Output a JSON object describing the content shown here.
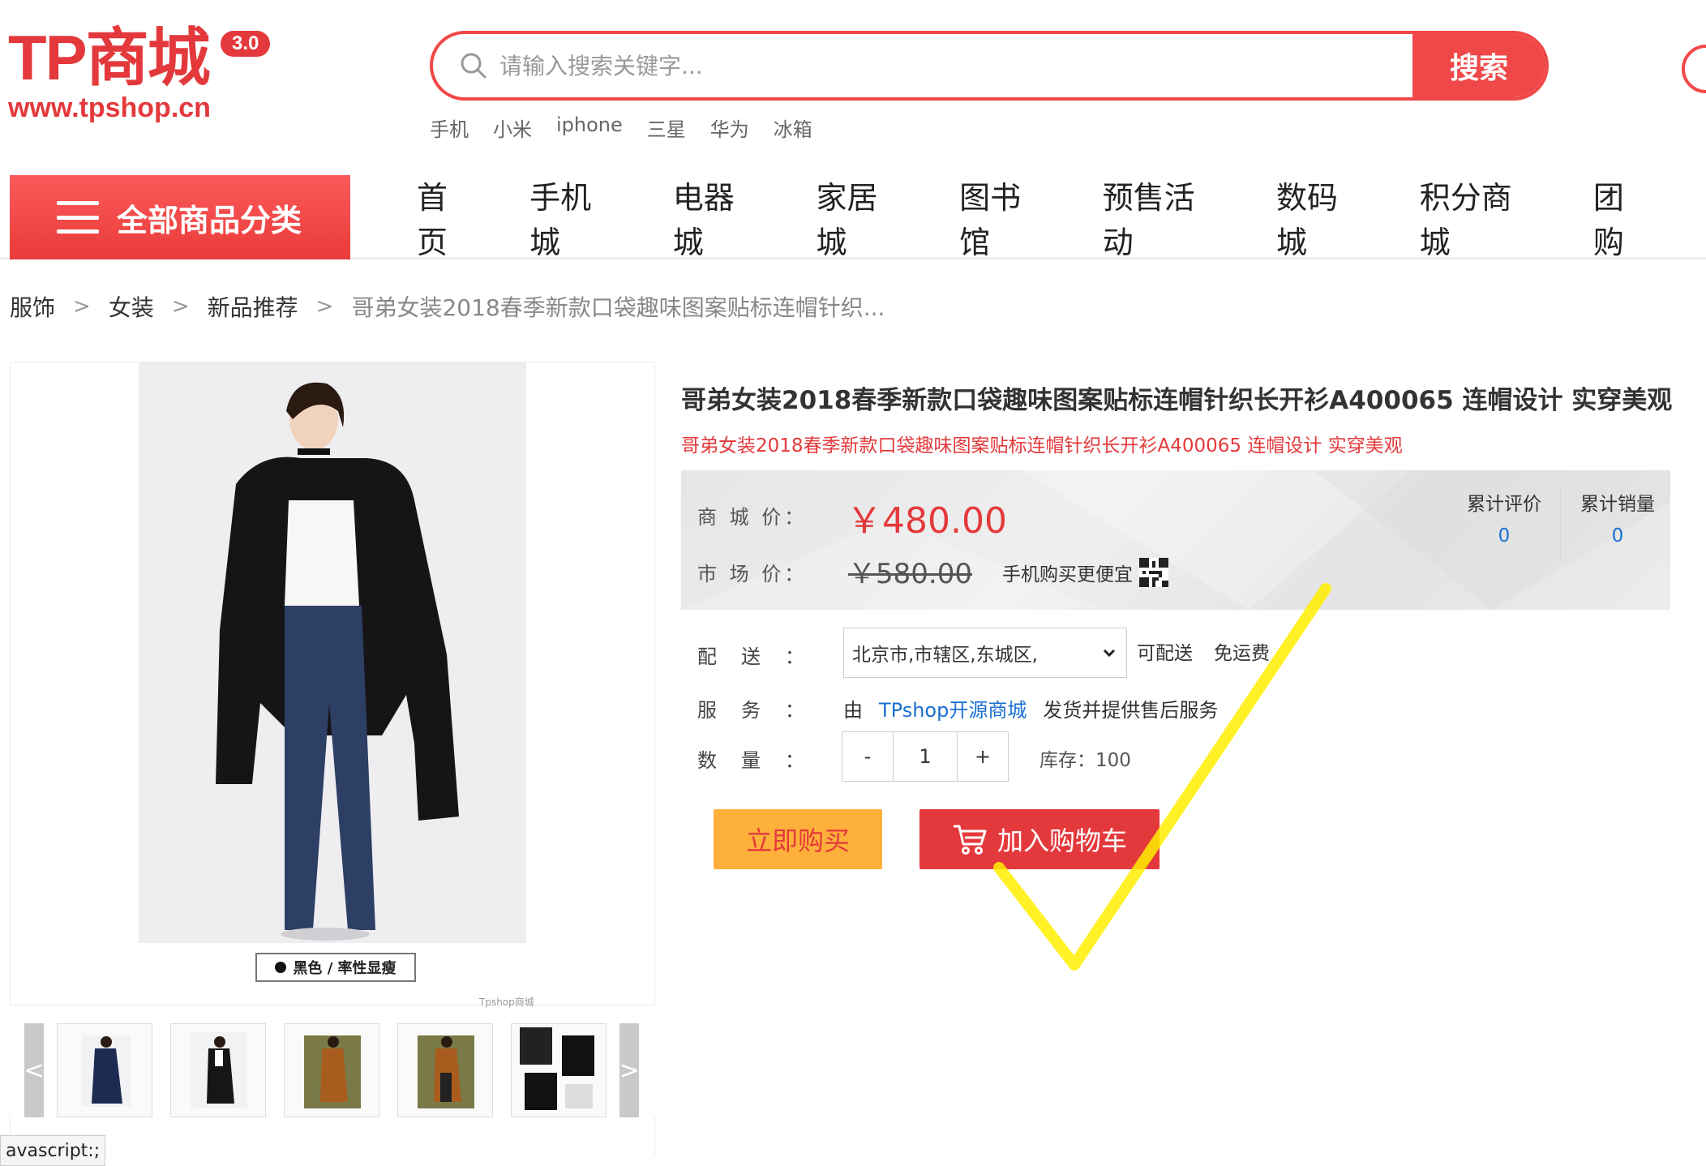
{
  "header": {
    "logo_text": "TP商城",
    "logo_version": "3.0",
    "logo_url": "www.tpshop.cn",
    "search_placeholder": "请输入搜索关键字...",
    "search_button": "搜索",
    "hot_keywords": [
      "手机",
      "小米",
      "iphone",
      "三星",
      "华为",
      "冰箱"
    ]
  },
  "nav": {
    "category_button": "全部商品分类",
    "items": [
      "首页",
      "手机城",
      "电器城",
      "家居城",
      "图书馆",
      "预售活动",
      "数码城",
      "积分商城",
      "团购"
    ]
  },
  "breadcrumb": [
    "服饰",
    "女装",
    "新品推荐",
    "哥弟女装2018春季新款口袋趣味图案贴标连帽针织..."
  ],
  "gallery": {
    "tag_text": "黑色 / 率性显瘦",
    "watermark": "Tpshop商城",
    "prev_arrow": "<",
    "next_arrow": ">"
  },
  "status_bar": "avascript:;",
  "product": {
    "title": "哥弟女装2018春季新款口袋趣味图案贴标连帽针织长开衫A400065 连帽设计 实穿美观",
    "subtitle": "哥弟女装2018春季新款口袋趣味图案贴标连帽针织长开衫A400065 连帽设计 实穿美观",
    "shop_price_label": "商 城 价：",
    "shop_price": "￥480.00",
    "market_price_label": "市 场 价：",
    "market_price": "￥580.00",
    "mobile_promo": "手机购买更便宜",
    "reviews_label": "累计评价",
    "reviews_count": "0",
    "sales_label": "累计销量",
    "sales_count": "0",
    "delivery_label": "配送：",
    "delivery_region": "北京市,市辖区,东城区,",
    "delivery_status": "可配送",
    "shipping_fee": "免运费",
    "service_label": "服务：",
    "service_prefix": "由",
    "service_shop": "TPshop开源商城",
    "service_suffix": "发货并提供售后服务",
    "quantity_label": "数量：",
    "qty_minus": "-",
    "qty_value": "1",
    "qty_plus": "+",
    "stock_text": "库存：100",
    "buy_now": "立即购买",
    "add_to_cart": "加入购物车"
  },
  "colors": {
    "brand_red": "#e4393c",
    "buy_now_bg": "#fdb03a",
    "link_blue": "#1a6fd1",
    "annotation_yellow": "#ffee00"
  }
}
